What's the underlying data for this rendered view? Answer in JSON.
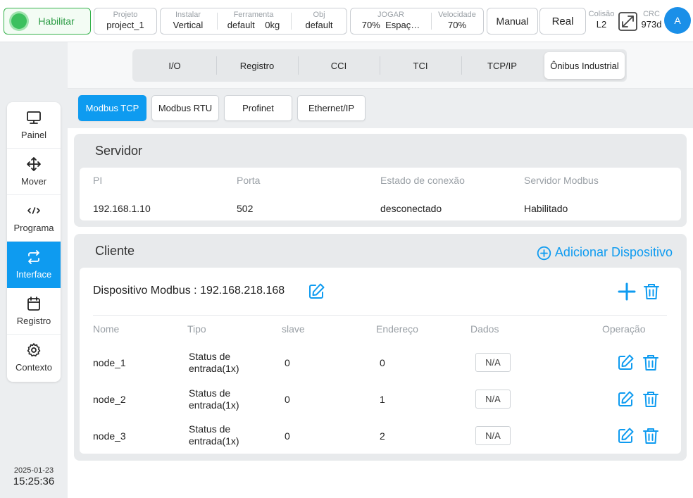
{
  "topbar": {
    "enable_label": "Habilitar",
    "project": {
      "label": "Projeto",
      "value": "project_1"
    },
    "install": {
      "label": "Instalar",
      "value": "Vertical"
    },
    "tool": {
      "label": "Ferramenta",
      "value": "default",
      "weight": "0kg"
    },
    "obj": {
      "label": "Obj",
      "value": "default"
    },
    "jog": {
      "label": "JOGAR",
      "percent": "70%",
      "space": "Espaç…"
    },
    "speed": {
      "label": "Velocidade",
      "value": "70%"
    },
    "mode_manual": "Manual",
    "mode_real": "Real",
    "collision": {
      "label": "Colisão",
      "value": "L2"
    },
    "crc": {
      "label": "CRC",
      "value": "973d"
    },
    "avatar": "A"
  },
  "sidebar": {
    "items": [
      {
        "label": "Painel",
        "icon": "monitor-icon"
      },
      {
        "label": "Mover",
        "icon": "move-icon"
      },
      {
        "label": "Programa",
        "icon": "code-icon"
      },
      {
        "label": "Interface",
        "icon": "swap-icon",
        "active": true
      },
      {
        "label": "Registro",
        "icon": "calendar-icon"
      },
      {
        "label": "Contexto",
        "icon": "gear-icon"
      }
    ],
    "date": "2025-01-23",
    "time": "15:25:36"
  },
  "tabs": [
    {
      "label": "I/O"
    },
    {
      "label": "Registro"
    },
    {
      "label": "CCI"
    },
    {
      "label": "TCI"
    },
    {
      "label": "TCP/IP"
    },
    {
      "label": "Ônibus Industrial",
      "active": true
    }
  ],
  "subtabs": [
    {
      "label": "Modbus TCP",
      "active": true
    },
    {
      "label": "Modbus RTU"
    },
    {
      "label": "Profinet"
    },
    {
      "label": "Ethernet/IP"
    }
  ],
  "server": {
    "title": "Servidor",
    "headers": [
      "PI",
      "Porta",
      "Estado de conexão",
      "Servidor Modbus"
    ],
    "values": [
      "192.168.1.10",
      "502",
      "desconectado",
      "Habilitado"
    ]
  },
  "client": {
    "title": "Cliente",
    "add_device": "Adicionar Dispositivo",
    "device_title": "Dispositivo Modbus : 192.168.218.168",
    "headers": [
      "Nome",
      "Tipo",
      "slave",
      "Endereço",
      "Dados",
      "Operação"
    ],
    "rows": [
      {
        "name": "node_1",
        "type_line1": "Status de",
        "type_line2": "entrada(1x)",
        "slave": "0",
        "address": "0",
        "data": "N/A"
      },
      {
        "name": "node_2",
        "type_line1": "Status de",
        "type_line2": "entrada(1x)",
        "slave": "0",
        "address": "1",
        "data": "N/A"
      },
      {
        "name": "node_3",
        "type_line1": "Status de",
        "type_line2": "entrada(1x)",
        "slave": "0",
        "address": "2",
        "data": "N/A"
      }
    ]
  },
  "colors": {
    "accent": "#0e9bf0",
    "enable_green": "#3cc05e"
  }
}
